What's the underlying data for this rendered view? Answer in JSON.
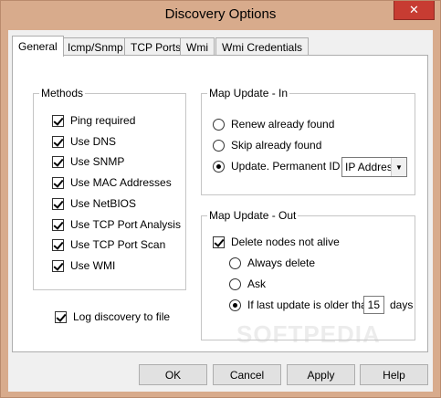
{
  "window": {
    "title": "Discovery Options",
    "close_glyph": "✕"
  },
  "tabs": [
    "General",
    "Icmp/Snmp",
    "TCP Ports",
    "Wmi",
    "Wmi Credentials"
  ],
  "methods": {
    "title": "Methods",
    "items": [
      {
        "label": "Ping required",
        "checked": true
      },
      {
        "label": "Use DNS",
        "checked": true
      },
      {
        "label": "Use SNMP",
        "checked": true
      },
      {
        "label": "Use MAC Addresses",
        "checked": true
      },
      {
        "label": "Use NetBIOS",
        "checked": true
      },
      {
        "label": "Use TCP Port Analysis",
        "checked": true
      },
      {
        "label": "Use TCP Port Scan",
        "checked": true
      },
      {
        "label": "Use WMI",
        "checked": true
      }
    ]
  },
  "log_discovery": {
    "label": "Log discovery to file",
    "checked": true
  },
  "map_in": {
    "title": "Map Update - In",
    "options": [
      {
        "label": "Renew already found",
        "checked": false
      },
      {
        "label": "Skip already found",
        "checked": false
      },
      {
        "label": "Update. Permanent ID is",
        "checked": true
      }
    ],
    "permanent_id_value": "IP Address"
  },
  "map_out": {
    "title": "Map Update - Out",
    "delete_not_alive": {
      "label": "Delete nodes not alive",
      "checked": true
    },
    "options": [
      {
        "label": "Always delete",
        "checked": false
      },
      {
        "label": "Ask",
        "checked": false
      },
      {
        "label": "If last update is older than",
        "checked": true
      }
    ],
    "days_value": "15",
    "days_unit": "days"
  },
  "buttons": {
    "ok": "OK",
    "cancel": "Cancel",
    "apply": "Apply",
    "help": "Help"
  },
  "watermark": "SOFTPEDIA"
}
